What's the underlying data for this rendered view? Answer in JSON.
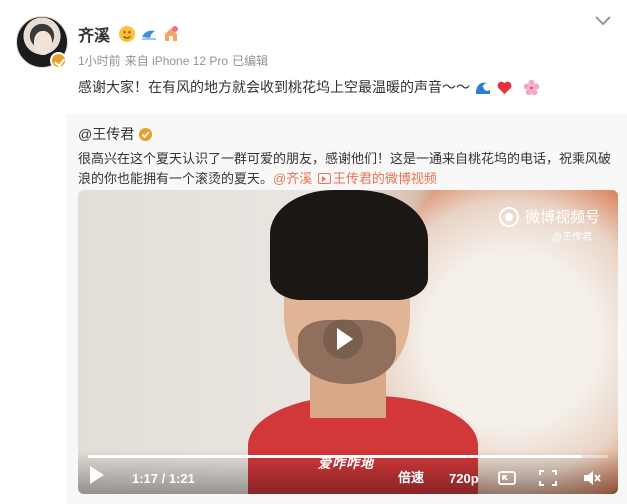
{
  "author": {
    "name": "齐溪",
    "time": "1小时前",
    "source": "来自 iPhone 12 Pro",
    "edited": "已编辑"
  },
  "post": {
    "text": "感谢大家！在有风的地方就会收到桃花坞上空最温暖的声音～～"
  },
  "repost": {
    "author": "@王传君",
    "text": "很高兴在这个夏天认识了一群可爱的朋友，感谢他们！这是一通来自桃花坞的电话，祝乘风破浪的你也能拥有一个滚烫的夏天。",
    "mention": "@齐溪",
    "video_link": "王传君的微博视频"
  },
  "video": {
    "watermark": "微博视频号",
    "watermark_sub": "@王传君",
    "subtitle": "爱咋咋地",
    "current_time": "1:17",
    "duration": "1:21",
    "time_separator": " / ",
    "progress": 0.95,
    "speed_label": "倍速",
    "quality_label": "720p"
  },
  "colors": {
    "link": "#eb7350",
    "badge": "#e8a12a",
    "repost_bg": "#f8f8f8"
  }
}
